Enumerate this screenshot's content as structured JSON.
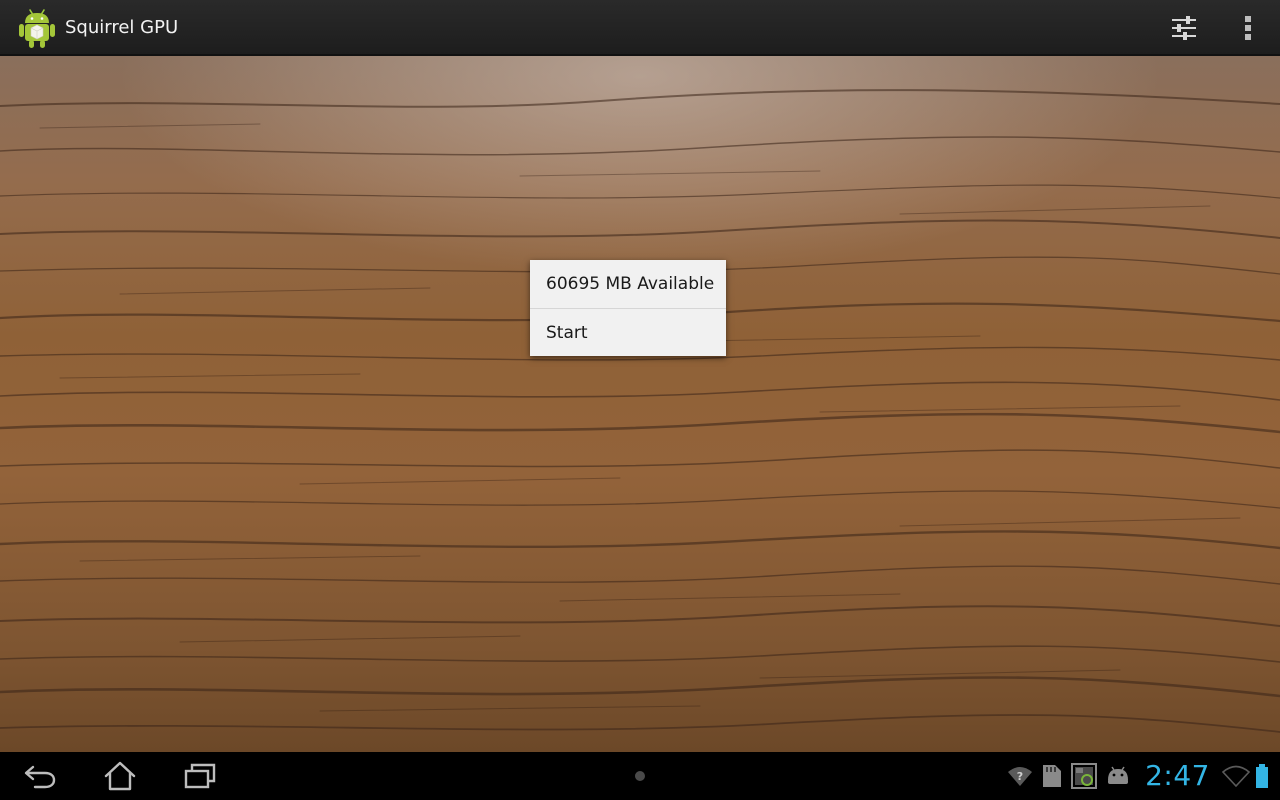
{
  "app": {
    "title": "Squirrel GPU",
    "icon": "android-robot-icon"
  },
  "action_bar": {
    "actions": [
      {
        "icon": "sliders-settings-icon"
      },
      {
        "icon": "overflow-menu-icon"
      }
    ]
  },
  "popup_menu": {
    "items": [
      {
        "label": "60695 MB Available"
      },
      {
        "label": "Start"
      }
    ]
  },
  "system_bar": {
    "nav": [
      "back-icon",
      "home-icon",
      "recent-apps-icon"
    ],
    "notifications": [
      "wifi-question-icon",
      "sd-card-icon",
      "screenshot-icon",
      "android-debug-icon"
    ],
    "clock": "2:47",
    "status_icons": [
      "wifi-signal-icon",
      "battery-icon"
    ],
    "accent_color": "#33b5e5"
  },
  "colors": {
    "action_bar": "#222222",
    "popup_background": "#f1f1f1",
    "wood_base": "#8f6137"
  }
}
